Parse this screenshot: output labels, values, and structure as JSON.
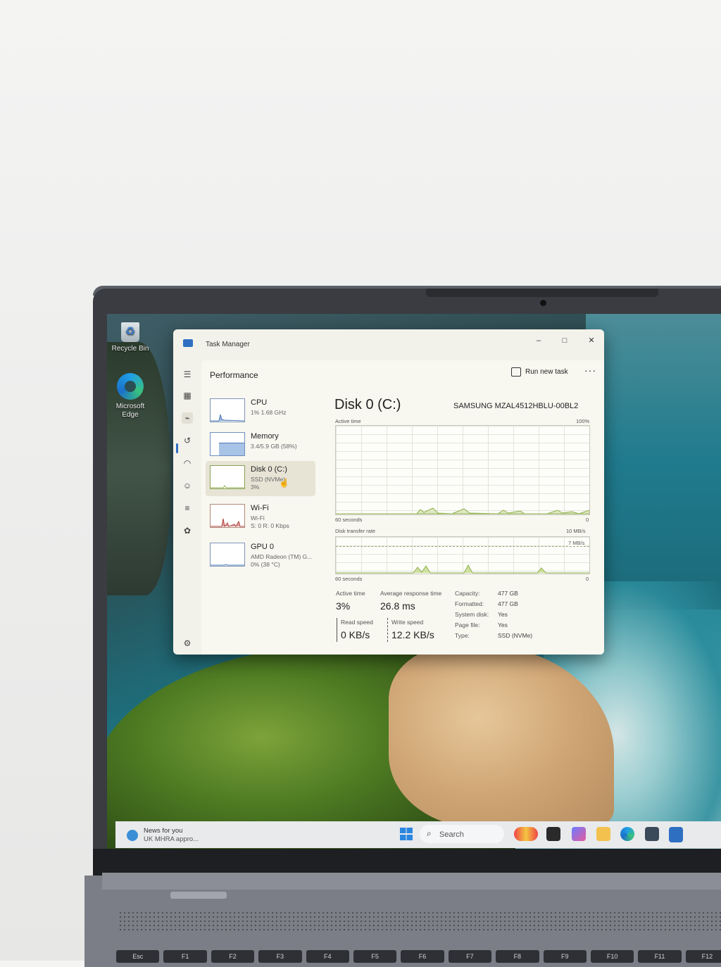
{
  "desktop": {
    "recycle_bin": "Recycle Bin",
    "edge_line1": "Microsoft",
    "edge_line2": "Edge"
  },
  "window": {
    "title": "Task Manager",
    "minimize": "–",
    "maximize": "□",
    "close": "✕"
  },
  "toolbar": {
    "section": "Performance",
    "run_new_task": "Run new task",
    "more": "···"
  },
  "devices": [
    {
      "name": "CPU",
      "sub1": "1% 1.68 GHz",
      "sub2": ""
    },
    {
      "name": "Memory",
      "sub1": "3.4/5.9 GB (58%)",
      "sub2": ""
    },
    {
      "name": "Disk 0 (C:)",
      "sub1": "SSD (NVMe)",
      "sub2": "3%"
    },
    {
      "name": "Wi-Fi",
      "sub1": "Wi-Fi",
      "sub2": "S: 0 R: 0 Kbps"
    },
    {
      "name": "GPU 0",
      "sub1": "AMD Radeon (TM) G...",
      "sub2": "0% (38 °C)"
    }
  ],
  "detail": {
    "title": "Disk 0 (C:)",
    "model": "SAMSUNG MZAL4512HBLU-00BL2",
    "graph1_label": "Active time",
    "graph1_max": "100%",
    "graph1_time": "60 seconds",
    "graph1_min": "0",
    "graph2_label": "Disk transfer rate",
    "graph2_max": "10 MB/s",
    "graph2_line": "7 MB/s",
    "graph2_time": "60 seconds",
    "graph2_min": "0"
  },
  "stats": {
    "active_time_label": "Active time",
    "active_time": "3%",
    "avg_resp_label": "Average response time",
    "avg_resp": "26.8 ms",
    "read_label": "Read speed",
    "read": "0 KB/s",
    "write_label": "Write speed",
    "write": "12.2 KB/s"
  },
  "properties": [
    {
      "key": "Capacity:",
      "value": "477 GB"
    },
    {
      "key": "Formatted:",
      "value": "477 GB"
    },
    {
      "key": "System disk:",
      "value": "Yes"
    },
    {
      "key": "Page file:",
      "value": "Yes"
    },
    {
      "key": "Type:",
      "value": "SSD (NVMe)"
    }
  ],
  "taskbar": {
    "news_title": "News for you",
    "news_sub": "UK MHRA appro...",
    "search": "Search"
  },
  "keyboard": [
    "Esc",
    "F1",
    "F2",
    "F3",
    "F4",
    "F5",
    "F6",
    "F7",
    "F8",
    "F9",
    "F10",
    "F11",
    "F12"
  ],
  "colors": {
    "accent": "#2f6fc2",
    "disk_graph": "#8fb04a",
    "window_bg": "#f3f2ea"
  }
}
